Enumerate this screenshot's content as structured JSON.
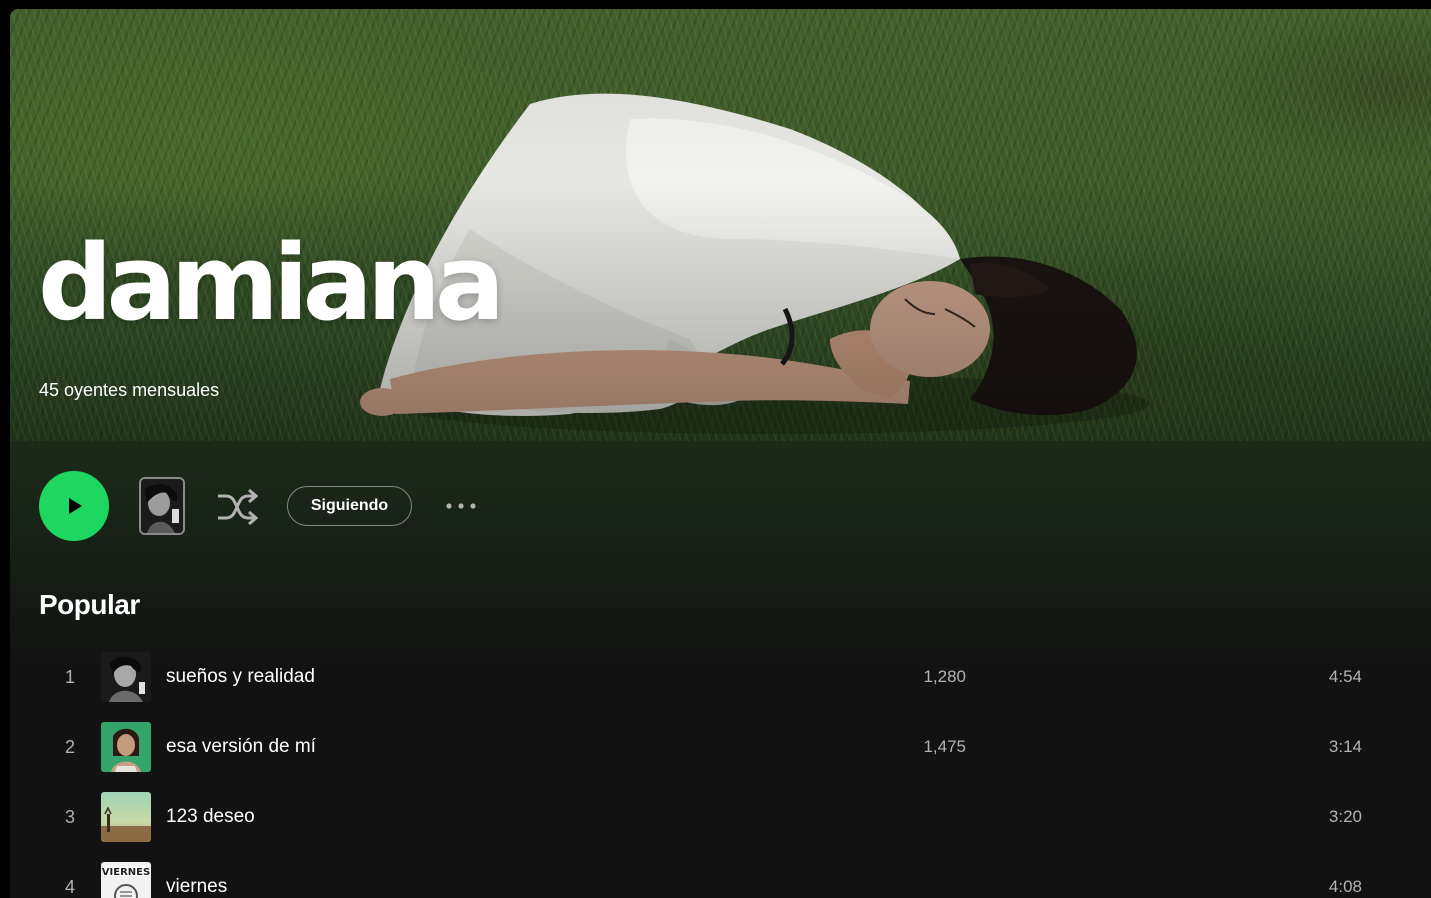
{
  "artist": {
    "name": "damiana",
    "monthly_listeners": "45 oyentes mensuales"
  },
  "actions": {
    "play_icon": "play-icon",
    "shuffle_icon": "shuffle-icon",
    "follow_label": "Siguiendo",
    "more_icon": "more-options-icon"
  },
  "popular": {
    "title": "Popular",
    "tracks": [
      {
        "number": "1",
        "title": "sueños y realidad",
        "plays": "1,280",
        "duration": "4:54"
      },
      {
        "number": "2",
        "title": "esa versión de mí",
        "plays": "1,475",
        "duration": "3:14"
      },
      {
        "number": "3",
        "title": "123 deseo",
        "plays": "",
        "duration": "3:20"
      },
      {
        "number": "4",
        "title": "viernes",
        "plays": "",
        "duration": "4:08"
      }
    ]
  },
  "colors": {
    "accent": "#1ed760",
    "background": "#121212",
    "text_secondary": "#b3b3b3"
  }
}
